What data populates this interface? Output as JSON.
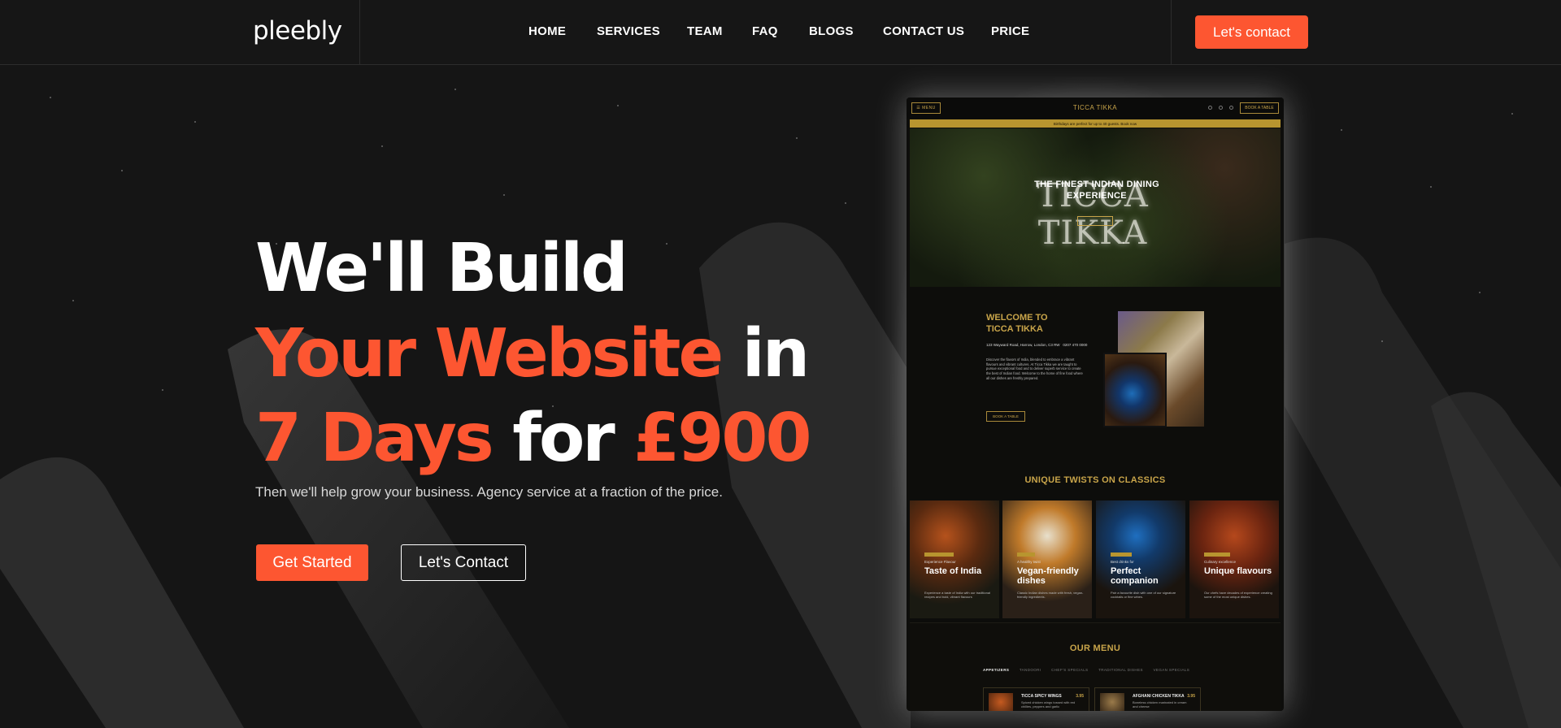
{
  "brand": {
    "logo": "pleebly"
  },
  "nav": {
    "items": [
      "HOME",
      "SERVICES",
      "TEAM",
      "FAQ",
      "BLOGS",
      "CONTACT US",
      "PRICE"
    ],
    "cta": "Let's contact"
  },
  "hero": {
    "line1": "We'll Build",
    "line2_accent": "Your Website",
    "line2_rest": " in",
    "line3_accent1": "7 Days",
    "line3_mid": " for ",
    "line3_accent2": "£900",
    "subtitle": "Then we'll help grow your business. Agency service at a fraction of the price.",
    "primary_button": "Get Started",
    "secondary_button": "Let's Contact"
  },
  "mockup": {
    "menu_button": "☰ MENU",
    "brand": "TICCA TIKKA",
    "book_button": "BOOK A TABLE",
    "banner": "Birthdays are perfect for up to 40 guests. Book now",
    "hero_sign": "TICCA TIKKA",
    "hero_title": "THE FINEST INDIAN DINING EXPERIENCE",
    "welcome_title": "WELCOME TO TICCA TIKKA",
    "address": "123 Wayward Road, Harrow, London, C3 RW",
    "phone": "0207 470 0000",
    "welcome_text": "Discover the flavors of India, blended to embrace a vibrant flavours and vibrant cultures. At Ticca Tikka we are taught to pursue exceptional food and to deliver superb service to create the best of Indian food. Welcome to the home of fine food where all our dishes are freshly prepared.",
    "welcome_button": "BOOK A TABLE",
    "twists_title": "UNIQUE TWISTS ON CLASSICS",
    "cards": [
      {
        "sub": "Experience Flavour",
        "title": "Taste of India",
        "desc": "Experience a taste of India with our traditional recipes and bold, vibrant flavours"
      },
      {
        "sub": "A healthy twist",
        "title": "Vegan-friendly dishes",
        "desc": "Classic Indian dishes made with fresh, vegan-friendly ingredients."
      },
      {
        "sub": "Best drinks for",
        "title": "Perfect companion",
        "desc": "Pair a favourite dish with one of our signature cocktails or fine wines."
      },
      {
        "sub": "Culinary excellence",
        "title": "Unique flavours",
        "desc": "Our chefs have decades of experience creating some of the most unique dishes."
      }
    ],
    "menu_title": "OUR MENU",
    "menu_tabs": [
      "APPETIZERS",
      "TANDOORI",
      "CHEF'S SPECIALS",
      "TRADITIONAL DISHES",
      "VEGAN SPECIALS"
    ],
    "dishes": [
      {
        "name": "TICCA SPICY WINGS",
        "price": "3.95",
        "desc": "Spiced chicken wings tossed with red chillies, peppers and garlic"
      },
      {
        "name": "AFGHANI CHICKEN TIKKA",
        "price": "3.95",
        "desc": "Boneless chicken marinated in cream and cheese"
      }
    ]
  }
}
